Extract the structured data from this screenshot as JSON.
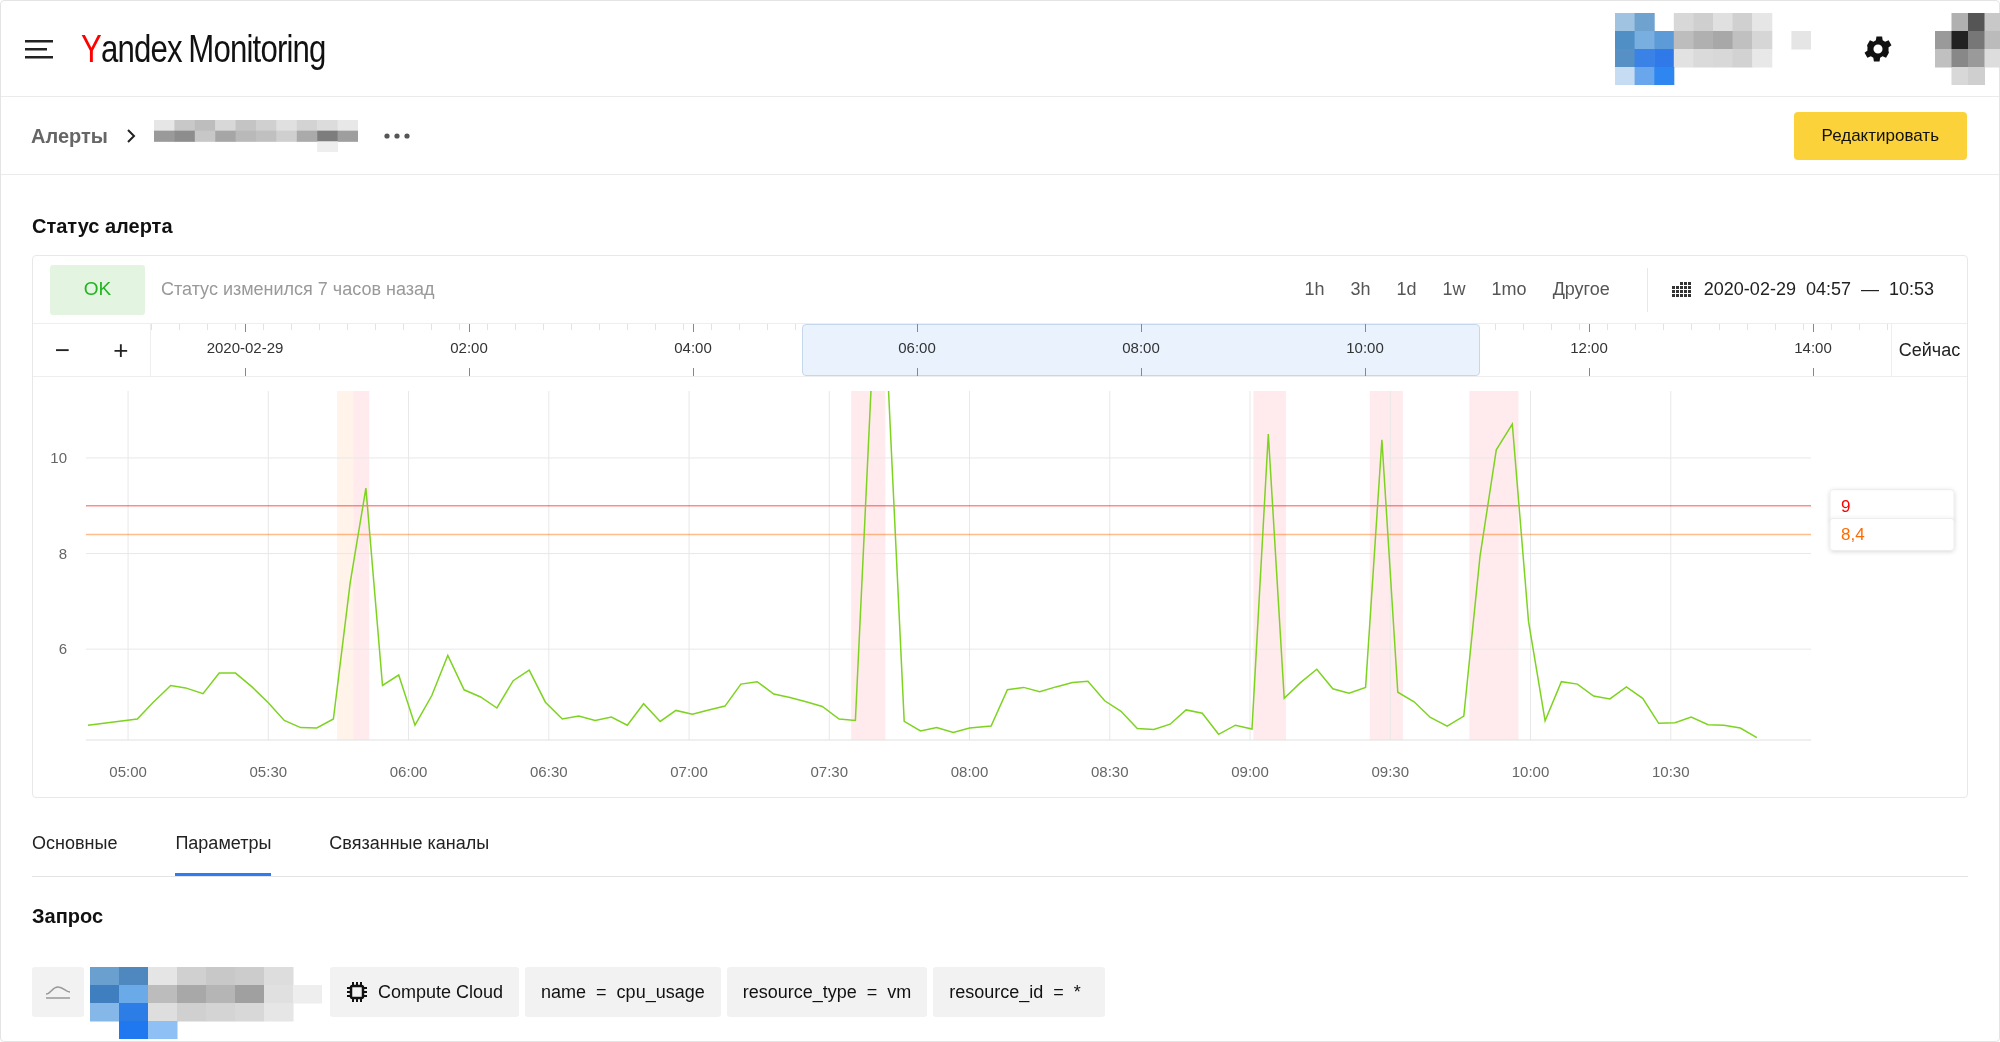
{
  "header": {
    "logo": {
      "brand": "Yandex",
      "product": "Monitoring"
    }
  },
  "breadcrumbs": {
    "root": "Алерты"
  },
  "edit_button": "Редактировать",
  "status_section": {
    "title": "Статус алерта",
    "status": "OK",
    "status_note": "Статус изменился 7 часов назад",
    "ranges": [
      "1h",
      "3h",
      "1d",
      "1w",
      "1mo",
      "Другое"
    ],
    "date": "2020-02-29",
    "time_from": "04:57",
    "dash": "—",
    "time_to": "10:53",
    "zoom_out": "−",
    "zoom_in": "+",
    "now_button": "Сейчас",
    "timeline": [
      {
        "label": "2020-02-29",
        "selected": false
      },
      {
        "label": "02:00",
        "selected": false
      },
      {
        "label": "04:00",
        "selected": false
      },
      {
        "label": "06:00",
        "selected": true
      },
      {
        "label": "08:00",
        "selected": true
      },
      {
        "label": "10:00",
        "selected": true
      },
      {
        "label": "12:00",
        "selected": false
      },
      {
        "label": "14:00",
        "selected": false
      }
    ],
    "chart_data": {
      "type": "line",
      "grid": true,
      "xlim": [
        4.85,
        11.0
      ],
      "ylim": [
        4.1,
        11.4
      ],
      "xticks": [
        {
          "value": 5,
          "label": "05:00"
        },
        {
          "value": 5.5,
          "label": "05:30"
        },
        {
          "value": 6,
          "label": "06:00"
        },
        {
          "value": 6.5,
          "label": "06:30"
        },
        {
          "value": 7,
          "label": "07:00"
        },
        {
          "value": 7.5,
          "label": "07:30"
        },
        {
          "value": 8,
          "label": "08:00"
        },
        {
          "value": 8.5,
          "label": "08:30"
        },
        {
          "value": 9,
          "label": "09:00"
        },
        {
          "value": 9.5,
          "label": "09:30"
        },
        {
          "value": 10,
          "label": "10:00"
        },
        {
          "value": 10.5,
          "label": "10:30"
        }
      ],
      "yticks": [
        6,
        8,
        10
      ],
      "x": [
        4.857,
        5.033,
        5.088,
        5.152,
        5.205,
        5.267,
        5.325,
        5.383,
        5.442,
        5.5,
        5.557,
        5.615,
        5.673,
        5.732,
        5.792,
        5.848,
        5.907,
        5.965,
        6.023,
        6.083,
        6.14,
        6.198,
        6.257,
        6.315,
        6.373,
        6.43,
        6.488,
        6.548,
        6.607,
        6.665,
        6.723,
        6.78,
        6.838,
        6.897,
        6.953,
        7.012,
        7.07,
        7.128,
        7.185,
        7.243,
        7.302,
        7.36,
        7.417,
        7.475,
        7.535,
        7.593,
        7.652,
        7.708,
        7.767,
        7.825,
        7.883,
        7.942,
        8.0,
        8.077,
        8.135,
        8.193,
        8.25,
        8.308,
        8.367,
        8.422,
        8.482,
        8.54,
        8.598,
        8.657,
        8.715,
        8.772,
        8.83,
        8.888,
        8.948,
        9.007,
        9.065,
        9.122,
        9.18,
        9.238,
        9.295,
        9.353,
        9.412,
        9.47,
        9.527,
        9.585,
        9.643,
        9.703,
        9.762,
        9.82,
        9.878,
        9.935,
        9.993,
        10.052,
        10.11,
        10.167,
        10.225,
        10.283,
        10.342,
        10.4,
        10.457,
        10.515,
        10.573,
        10.633,
        10.69,
        10.748,
        10.807
      ],
      "series": [
        {
          "color": "#7ed321",
          "values": [
            4.41,
            4.54,
            4.88,
            5.24,
            5.19,
            5.07,
            5.5,
            5.5,
            5.21,
            4.88,
            4.51,
            4.36,
            4.35,
            4.54,
            7.39,
            9.37,
            5.24,
            5.46,
            4.41,
            5.03,
            5.87,
            5.15,
            5.0,
            4.77,
            5.34,
            5.56,
            4.89,
            4.54,
            4.6,
            4.51,
            4.58,
            4.41,
            4.86,
            4.49,
            4.72,
            4.64,
            4.73,
            4.81,
            5.27,
            5.32,
            5.06,
            4.99,
            4.9,
            4.8,
            4.54,
            4.51,
            null,
            null,
            4.49,
            4.29,
            4.36,
            4.26,
            4.35,
            4.39,
            5.15,
            5.2,
            5.11,
            5.21,
            5.3,
            5.33,
            4.92,
            4.7,
            4.34,
            4.32,
            4.43,
            4.73,
            4.66,
            4.22,
            4.41,
            4.33,
            10.5,
            4.97,
            5.3,
            5.58,
            5.17,
            5.08,
            5.2,
            10.38,
            5.1,
            4.9,
            4.57,
            4.39,
            4.6,
            7.94,
            10.17,
            10.71,
            6.58,
            4.5,
            5.32,
            5.27,
            5.02,
            4.96,
            5.21,
            4.97,
            4.45,
            4.46,
            4.58,
            4.42,
            4.41,
            4.35,
            4.15
          ]
        }
      ],
      "bands": [
        {
          "axis": "x",
          "from": 5.745,
          "to": 5.803,
          "color": "#fff3ea"
        },
        {
          "axis": "x",
          "from": 5.803,
          "to": 5.86,
          "color": "#ffebed"
        },
        {
          "axis": "x",
          "from": 7.578,
          "to": 7.7,
          "color": "#ffebed"
        },
        {
          "axis": "x",
          "from": 9.012,
          "to": 9.128,
          "color": "#ffebed"
        },
        {
          "axis": "x",
          "from": 9.427,
          "to": 9.545,
          "color": "#ffebed"
        },
        {
          "axis": "x",
          "from": 9.782,
          "to": 9.957,
          "color": "#ffebed"
        }
      ],
      "ref_lines": [
        {
          "axis": "y",
          "value": 9,
          "label": "9",
          "color": "#ff0000"
        },
        {
          "axis": "y",
          "value": 8.4,
          "label": "8,4",
          "color": "#ff6a00"
        }
      ]
    }
  },
  "tabs": [
    {
      "label": "Основные",
      "selected": false
    },
    {
      "label": "Параметры",
      "selected": true
    },
    {
      "label": "Связанные каналы",
      "selected": false
    }
  ],
  "query": {
    "title": "Запрос",
    "chips": [
      {
        "kind": "icon"
      },
      {
        "kind": "picture"
      },
      {
        "kind": "service",
        "label": "Compute Cloud"
      },
      {
        "kind": "selector",
        "label": "name  =  cpu_usage"
      },
      {
        "kind": "selector",
        "label": "resource_type  =  vm"
      },
      {
        "kind": "selector",
        "label": "resource_id  =  *"
      }
    ]
  }
}
